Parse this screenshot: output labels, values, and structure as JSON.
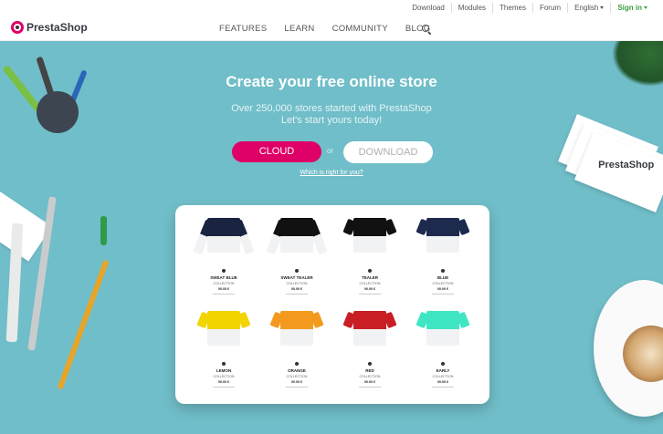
{
  "topbar": {
    "links": [
      "Download",
      "Modules",
      "Themes",
      "Forum"
    ],
    "language": "English",
    "signin": "Sign in"
  },
  "nav": {
    "logo": "PrestaShop",
    "items": [
      "FEATURES",
      "LEARN",
      "COMMUNITY",
      "BLOG"
    ]
  },
  "hero": {
    "title": "Create your free online store",
    "subtitle_line1": "Over 250,000 stores started with PrestaShop",
    "subtitle_line2": "Let's start yours today!",
    "cloud_label": "CLOUD",
    "or_label": "or",
    "download_label": "DOWNLOAD",
    "which_link": "Which is right for you?"
  },
  "cards_text": "PrestaShop",
  "products": [
    {
      "name": "SWEAT BLUE",
      "collection": "COLLECTION",
      "price": "00.00 €",
      "top": "#1a2440",
      "long": true
    },
    {
      "name": "SWEAT TEALER",
      "collection": "COLLECTION",
      "price": "00.00 €",
      "top": "#111111",
      "long": true
    },
    {
      "name": "TEALER",
      "collection": "COLLECTION",
      "price": "00.00 €",
      "top": "#111111",
      "long": false
    },
    {
      "name": "BLUE",
      "collection": "COLLECTION",
      "price": "00.00 €",
      "top": "#1d2a4e",
      "long": false
    },
    {
      "name": "LEMON",
      "collection": "COLLECTION",
      "price": "00.00 €",
      "top": "#f1d400",
      "long": false
    },
    {
      "name": "ORANGE",
      "collection": "COLLECTION",
      "price": "00.00 €",
      "top": "#f39a1e",
      "long": false
    },
    {
      "name": "RED",
      "collection": "COLLECTION",
      "price": "00.00 €",
      "top": "#c81e24",
      "long": false
    },
    {
      "name": "EARLY",
      "collection": "COLLECTION",
      "price": "00.00 €",
      "top": "#3ee6c4",
      "long": false
    }
  ],
  "colors": {
    "brand": "#df0067",
    "hero_bg": "#70bec9",
    "signin": "#3a9f3a"
  }
}
